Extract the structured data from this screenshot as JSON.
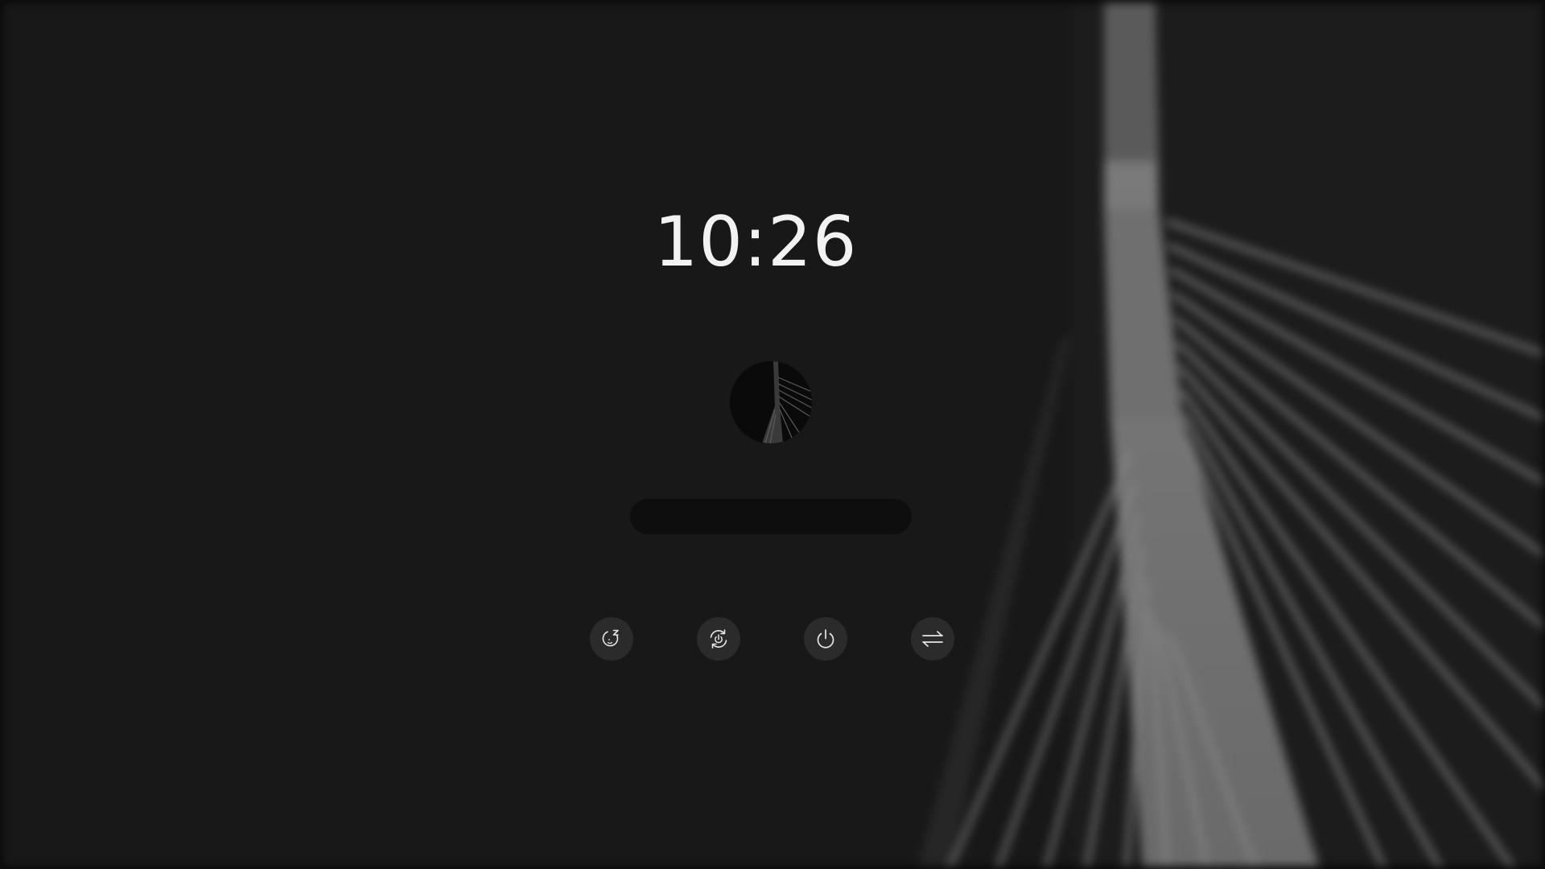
{
  "lockscreen": {
    "time": "10:26",
    "password": {
      "value": "",
      "placeholder": ""
    },
    "power_actions": [
      {
        "icon": "sleep-icon",
        "action": "suspend"
      },
      {
        "icon": "restart-icon",
        "action": "reboot"
      },
      {
        "icon": "power-icon",
        "action": "shutdown"
      },
      {
        "icon": "switch-user-icon",
        "action": "switch-user"
      }
    ]
  },
  "colors": {
    "background": "#181818",
    "button_background": "#2b2b2b",
    "input_background": "#0e0e0e",
    "text": "#f2f2f2"
  }
}
